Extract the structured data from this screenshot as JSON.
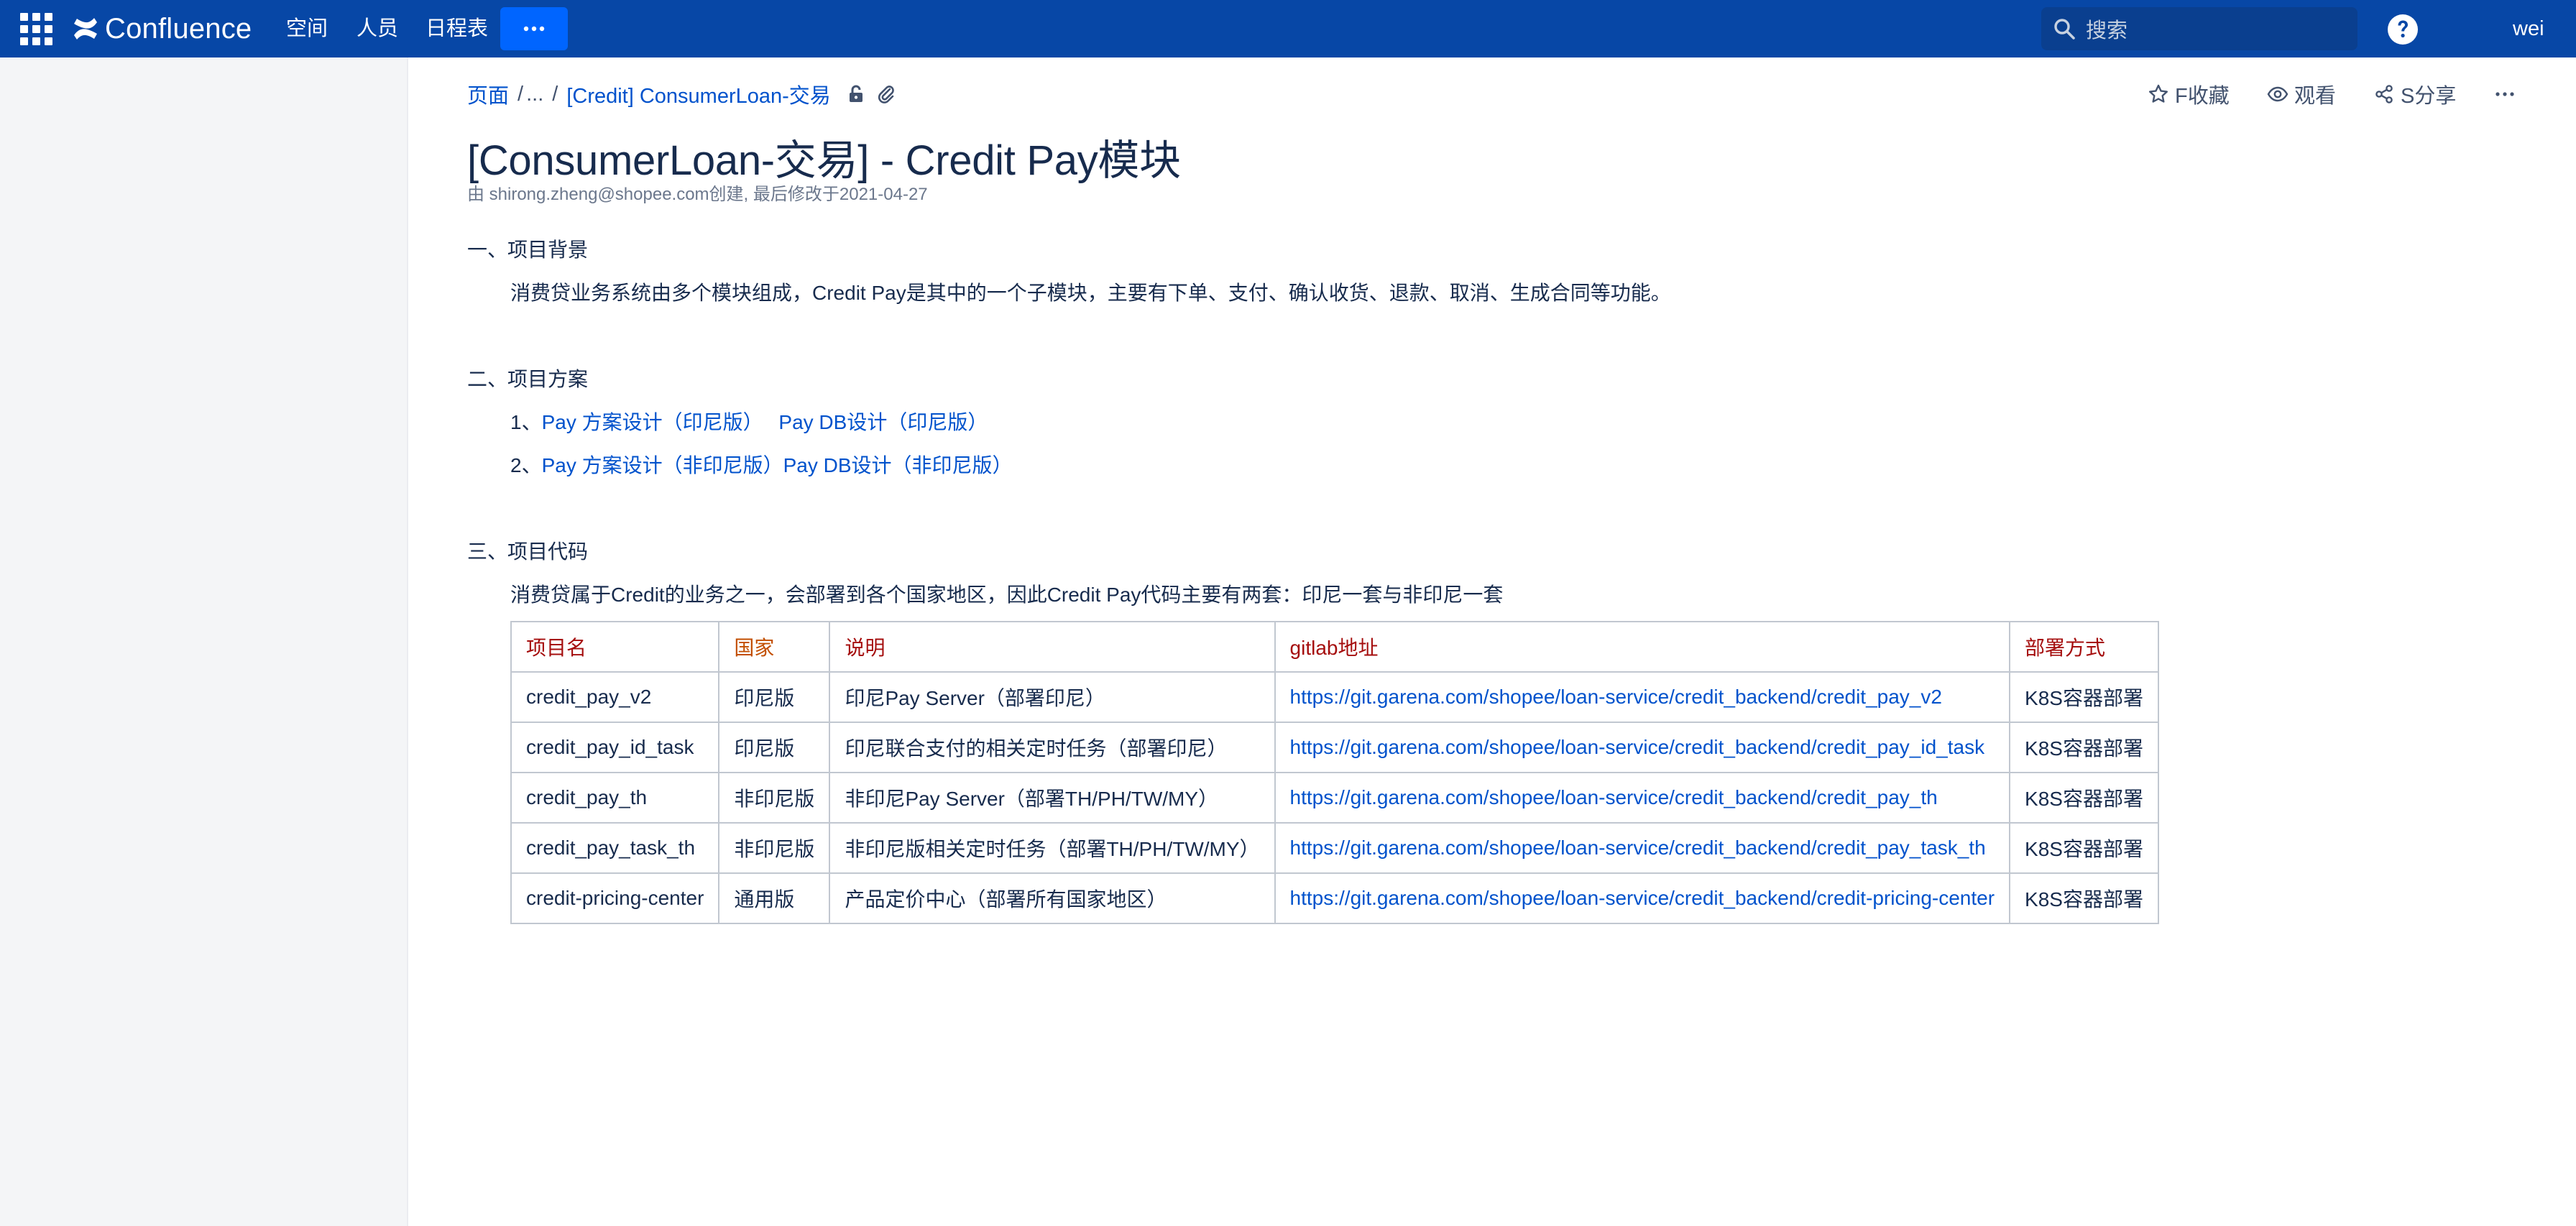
{
  "topbar": {
    "logo_text": "Confluence",
    "nav": [
      "空间",
      "人员",
      "日程表"
    ],
    "more_label": "···",
    "search_placeholder": "搜索",
    "user_name": "wei"
  },
  "breadcrumb": {
    "root": "页面",
    "ellipsis": "...",
    "current": "[Credit] ConsumerLoan-交易"
  },
  "actions": {
    "favorite": "F收藏",
    "watch": "观看",
    "share": "S分享"
  },
  "page": {
    "title": "[ConsumerLoan-交易] - Credit Pay模块",
    "byline": "由 shirong.zheng@shopee.com创建, 最后修改于2021-04-27"
  },
  "content": {
    "s1_title": "一、项目背景",
    "s1_text": "消费贷业务系统由多个模块组成，Credit Pay是其中的一个子模块，主要有下单、支付、确认收货、退款、取消、生成合同等功能。",
    "s2_title": "二、项目方案",
    "s2_items": [
      {
        "prefix": "1、",
        "link_a": "Pay 方案设计（印尼版）",
        "link_b": "Pay DB设计（印尼版）"
      },
      {
        "prefix": "2、",
        "link_a": "Pay 方案设计（非印尼版）",
        "link_b": "Pay DB设计（非印尼版）"
      }
    ],
    "s3_title": "三、项目代码",
    "s3_text": "消费贷属于Credit的业务之一，会部署到各个国家地区，因此Credit Pay代码主要有两套：印尼一套与非印尼一套"
  },
  "table": {
    "headers": [
      "项目名",
      "国家",
      "说明",
      "gitlab地址",
      "部署方式"
    ],
    "rows": [
      [
        "credit_pay_v2",
        "印尼版",
        "印尼Pay Server（部署印尼）",
        "https://git.garena.com/shopee/loan-service/credit_backend/credit_pay_v2",
        "K8S容器部署"
      ],
      [
        "credit_pay_id_task",
        "印尼版",
        "印尼联合支付的相关定时任务（部署印尼）",
        "https://git.garena.com/shopee/loan-service/credit_backend/credit_pay_id_task",
        "K8S容器部署"
      ],
      [
        "credit_pay_th",
        "非印尼版",
        "非印尼Pay Server（部署TH/PH/TW/MY）",
        "https://git.garena.com/shopee/loan-service/credit_backend/credit_pay_th",
        "K8S容器部署"
      ],
      [
        "credit_pay_task_th",
        "非印尼版",
        "非印尼版相关定时任务（部署TH/PH/TW/MY）",
        "https://git.garena.com/shopee/loan-service/credit_backend/credit_pay_task_th",
        "K8S容器部署"
      ],
      [
        "credit-pricing-center",
        "通用版",
        "产品定价中心（部署所有国家地区）",
        "https://git.garena.com/shopee/loan-service/credit_backend/credit-pricing-center",
        "K8S容器部署"
      ]
    ]
  }
}
